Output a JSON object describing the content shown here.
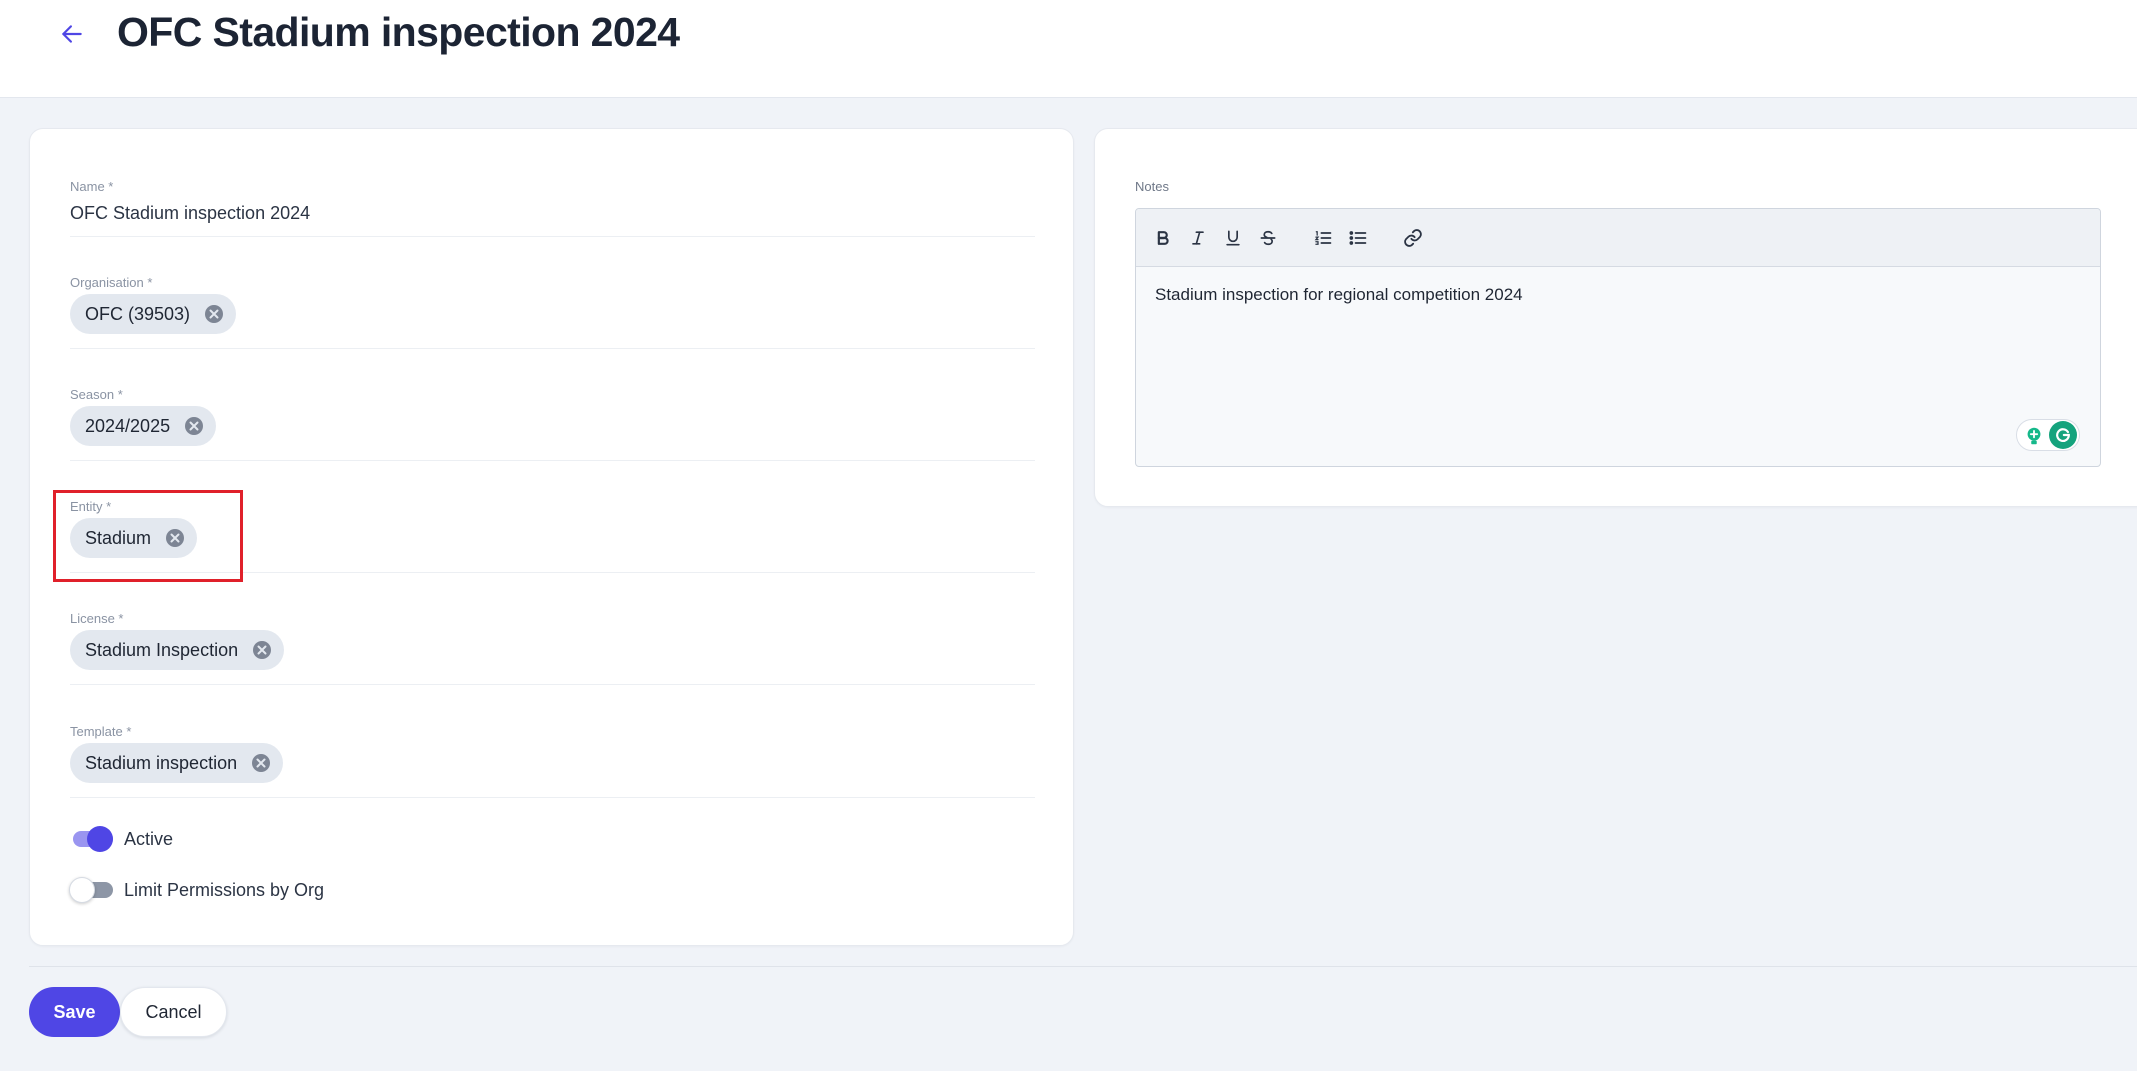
{
  "header": {
    "title": "OFC Stadium inspection 2024",
    "back_icon": "arrow-left-icon"
  },
  "form": {
    "name": {
      "label": "Name *",
      "value": "OFC Stadium inspection 2024"
    },
    "organisation": {
      "label": "Organisation *",
      "chip": "OFC (39503)"
    },
    "season": {
      "label": "Season *",
      "chip": "2024/2025"
    },
    "entity": {
      "label": "Entity *",
      "chip": "Stadium"
    },
    "license": {
      "label": "License *",
      "chip": "Stadium Inspection"
    },
    "template": {
      "label": "Template *",
      "chip": "Stadium inspection"
    },
    "active": {
      "label": "Active",
      "on": true
    },
    "limit_permissions": {
      "label": "Limit Permissions by Org",
      "on": false
    }
  },
  "notes": {
    "label": "Notes",
    "toolbar": [
      "bold-icon",
      "italic-icon",
      "underline-icon",
      "strikethrough-icon",
      "ordered-list-icon",
      "bullet-list-icon",
      "link-icon"
    ],
    "content": "Stadium inspection for regional competition 2024"
  },
  "actions": {
    "save_label": "Save",
    "cancel_label": "Cancel"
  },
  "colors": {
    "accent": "#4f46e5",
    "highlight": "#e0202a",
    "background": "#f0f3f8",
    "chip": "#e3e8ef"
  }
}
